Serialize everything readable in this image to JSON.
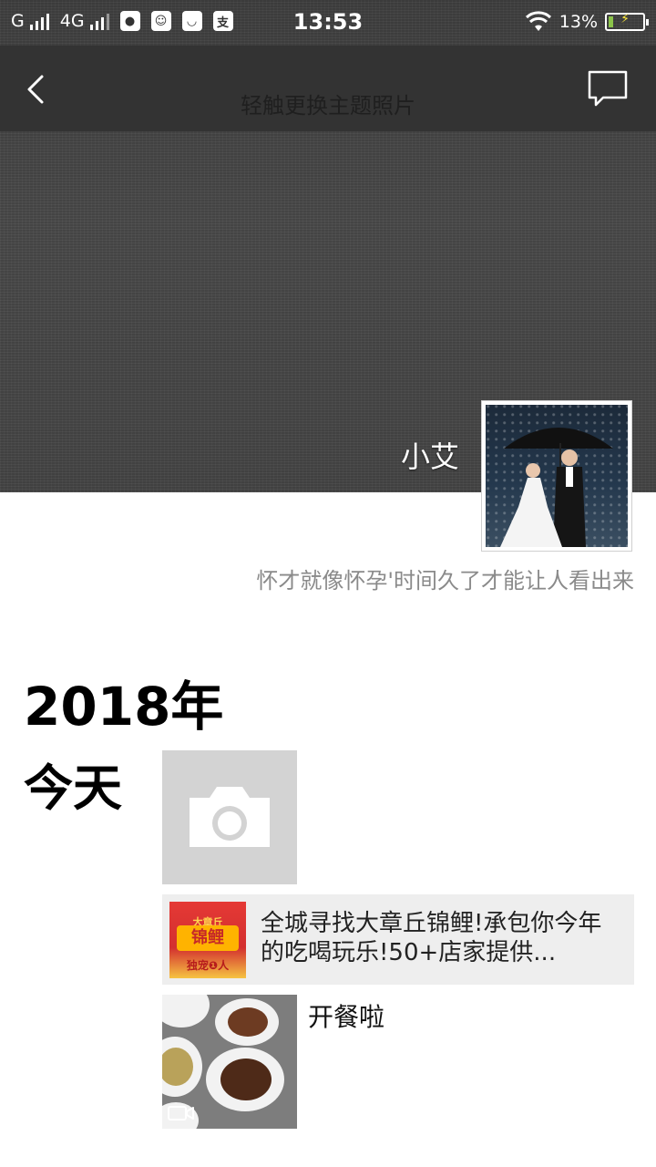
{
  "status_bar": {
    "carrier1": "G",
    "network": "4G",
    "time": "13:53",
    "battery_percent": "13%",
    "battery_level": 0.13
  },
  "nav": {
    "title": "轻触更换主题照片",
    "back_icon": "chevron-left-icon",
    "comment_icon": "comment-bubble-icon"
  },
  "profile": {
    "name": "小艾",
    "signature": "怀才就像怀孕'时间久了才能让人看出来"
  },
  "timeline": {
    "year": "2018年",
    "day": "今天",
    "share": {
      "text": "全城寻找大章丘锦鲤!承包你今年的吃喝玩乐!50+店家提供...",
      "thumb_top": "大章丘",
      "thumb_main": "锦鲤",
      "thumb_bottom": "独宠❶人"
    },
    "video": {
      "caption": "开餐啦"
    }
  },
  "colors": {
    "cover": "#464646",
    "navbar": "#333333",
    "tile_gray": "#d3d3d3",
    "share_bg": "#eeeeee",
    "signature": "#8a8a8a"
  }
}
